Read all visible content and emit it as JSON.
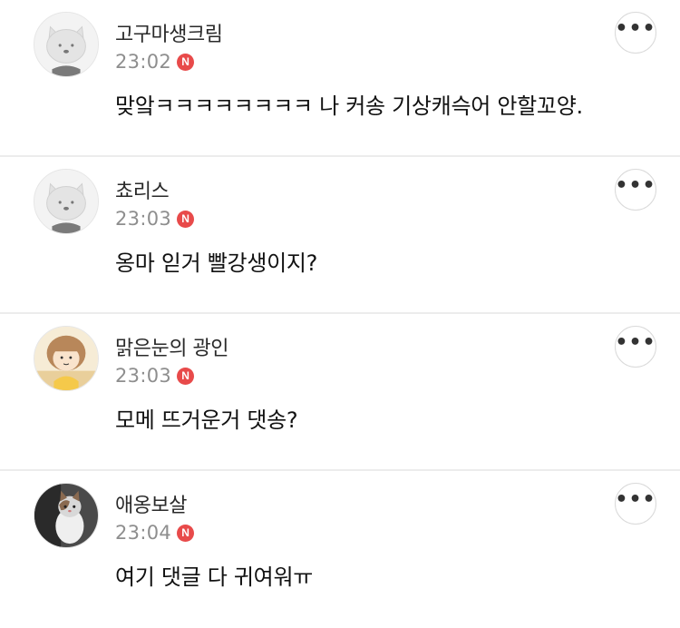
{
  "comments": [
    {
      "nickname": "고구마생크림",
      "time": "23:02",
      "badge": "N",
      "text": "맞앜ㅋㅋㅋㅋㅋㅋㅋㅋ 나 커송 기상캐슥어 안할꼬양.",
      "avatar": "default-cat-avatar",
      "more": "•••"
    },
    {
      "nickname": "쵸리스",
      "time": "23:03",
      "badge": "N",
      "text": "옹마 읻거 빨강생이지?",
      "avatar": "default-cat-avatar",
      "more": "•••"
    },
    {
      "nickname": "맑은눈의 광인",
      "time": "23:03",
      "badge": "N",
      "text": "모메 뜨거운거 댓송?",
      "avatar": "cartoon-person-avatar",
      "more": "•••"
    },
    {
      "nickname": "애옹보살",
      "time": "23:04",
      "badge": "N",
      "text": "여기 댓글 다 귀여워ㅠ",
      "avatar": "cat-photo-avatar",
      "more": "•••"
    }
  ],
  "colors": {
    "badge": "#e84a4a",
    "divider": "#ececec",
    "time": "#8e8e8e"
  }
}
